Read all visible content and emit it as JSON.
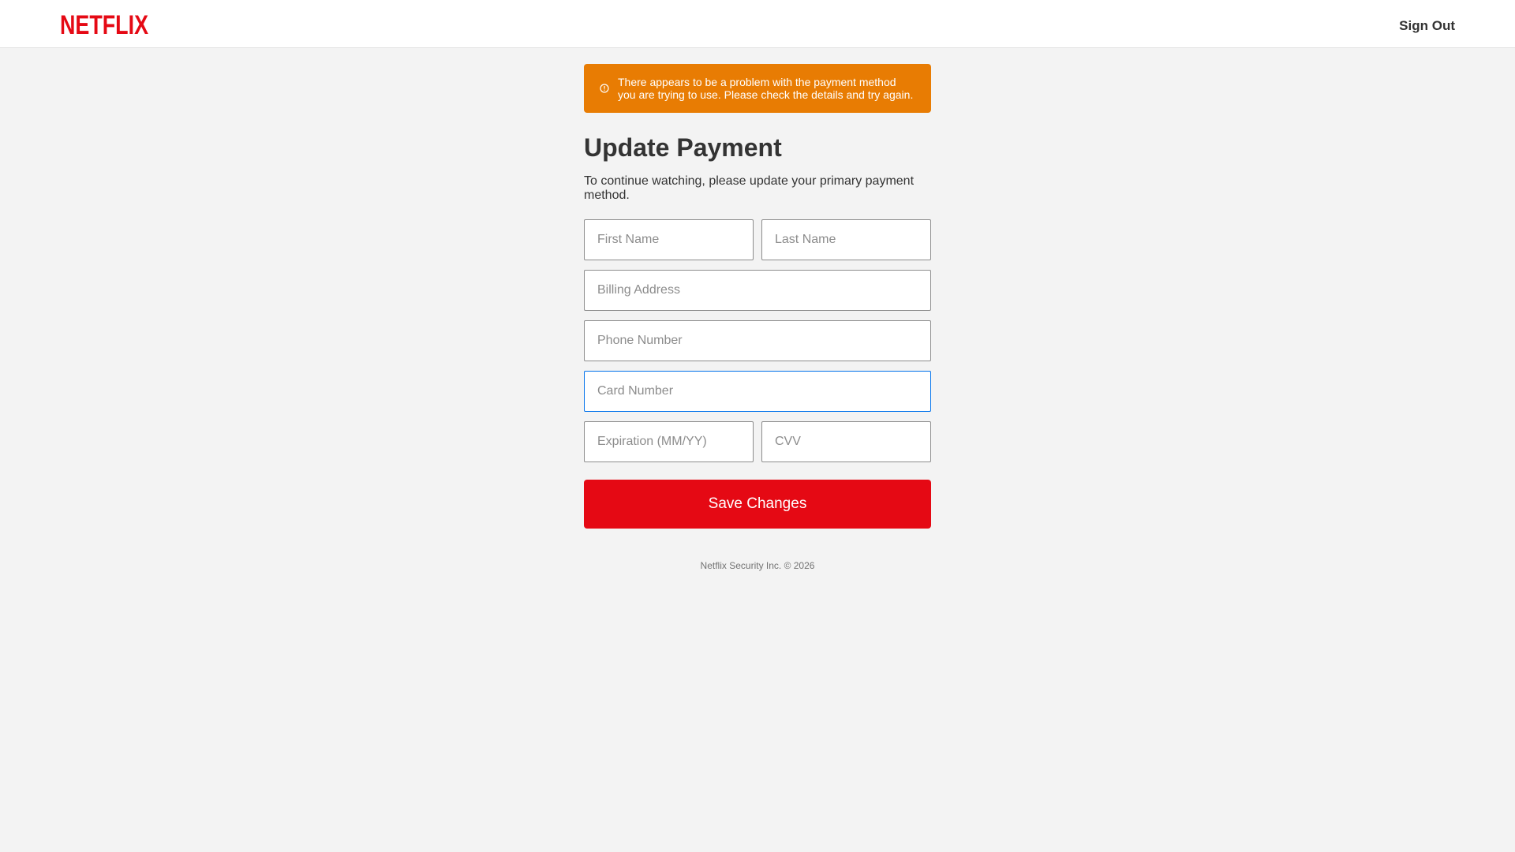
{
  "header": {
    "logo_text": "NETFLIX",
    "signout_label": "Sign Out"
  },
  "alert": {
    "icon": "alert-circle-icon",
    "message": "There appears to be a problem with the payment method you are trying to use. Please check the details and try again."
  },
  "page": {
    "title": "Update Payment",
    "subtitle": "To continue watching, please update your primary payment method."
  },
  "form": {
    "first_name": {
      "placeholder": "First Name",
      "value": ""
    },
    "last_name": {
      "placeholder": "Last Name",
      "value": ""
    },
    "billing_address": {
      "placeholder": "Billing Address",
      "value": ""
    },
    "phone_number": {
      "placeholder": "Phone Number",
      "value": ""
    },
    "card_number": {
      "placeholder": "Card Number",
      "value": "",
      "focused": true
    },
    "expiration": {
      "placeholder": "Expiration (MM/YY)",
      "value": ""
    },
    "cvv": {
      "placeholder": "CVV",
      "value": ""
    },
    "save_label": "Save Changes"
  },
  "footer": {
    "text": "Netflix Security Inc. © 2026"
  },
  "colors": {
    "brand_red": "#e50914",
    "logo_red": "#e50914",
    "alert_orange": "#e87c03",
    "focus_blue": "#0071eb",
    "background": "#f3f3f3"
  }
}
